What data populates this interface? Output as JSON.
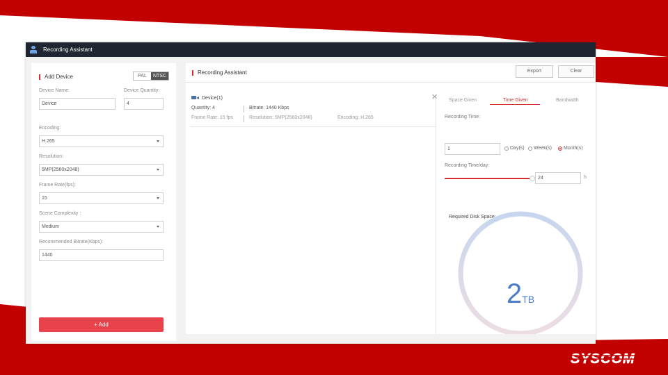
{
  "colors": {
    "accent_red": "#c20000",
    "panel_white": "#ffffff",
    "gauge_blue": "#4a7cc7"
  },
  "window": {
    "title": "Recording Assistant",
    "icon": "user-icon"
  },
  "add_device": {
    "title": "Add Device",
    "standard_toggle": {
      "options": [
        "PAL",
        "NTSC"
      ],
      "selected": "NTSC"
    },
    "device_name_label": "Device Name:",
    "device_name_value": "Device",
    "device_quantity_label": "Device Quantity:",
    "device_quantity_value": "4",
    "encoding_label": "Encoding:",
    "encoding_value": "H.265",
    "resolution_label": "Resolution:",
    "resolution_value": "5MP(2560x2048)",
    "frame_rate_label": "Frame Rate(fps):",
    "frame_rate_value": "15",
    "scene_label": "Scene Complexity :",
    "scene_value": "Medium",
    "bitrate_label": "Recommended Bitrate(Kbps):",
    "bitrate_value": "1440",
    "add_button": "+ Add"
  },
  "assistant": {
    "title": "Recording Assistant",
    "export_button": "Export",
    "clear_button": "Clear",
    "device_card": {
      "icon": "camera-icon",
      "name": "Device(1)",
      "quantity": "Quantity: 4",
      "bitrate": "Bitrate: 1440 Kbps",
      "frame_rate": "Frame Rate: 15 fps",
      "resolution": "Resolution: 5MP(2560x2048)",
      "encoding": "Encoding: H.265"
    },
    "tabs": [
      "Space Given",
      "Time Given",
      "Bandwidth"
    ],
    "active_tab": "Time Given",
    "recording_time_label": "Recording Time:",
    "recording_time_value": "1",
    "units": [
      {
        "label": "Day(s)",
        "selected": false
      },
      {
        "label": "Week(s)",
        "selected": false
      },
      {
        "label": "Month(s)",
        "selected": true
      }
    ],
    "time_per_day_label": "Recording Time/day:",
    "time_per_day_value": "24",
    "time_per_day_unit": "h",
    "time_per_day_fraction": 1.0,
    "disk_label": "Required Disk Space:",
    "disk_value": "2",
    "disk_unit": "TB"
  },
  "brand": {
    "logo_text": "SYSCOM"
  }
}
